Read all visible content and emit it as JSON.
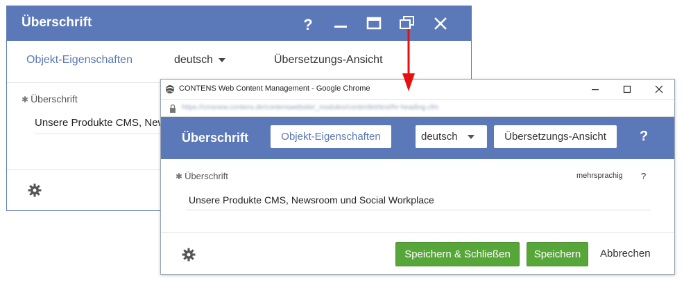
{
  "dialog_back": {
    "title": "Überschrift",
    "controls": {
      "help": "?"
    },
    "tabs": {
      "properties": "Objekt-Eigenschaften",
      "language": "deutsch",
      "translation": "Übersetzungs-Ansicht"
    },
    "field": {
      "label": "Überschrift",
      "value": "Unsere Produkte CMS, News"
    }
  },
  "browser": {
    "window_title": "CONTENS Web Content Management - Google Chrome",
    "url": "https://cmsnew.contens.de/contenswebsite/_modules/contentlet/text/hr-heading.cfm"
  },
  "dialog_front": {
    "title": "Überschrift",
    "tabs": {
      "properties": "Objekt-Eigenschaften",
      "language": "deutsch",
      "translation": "Übersetzungs-Ansicht"
    },
    "help": "?",
    "field": {
      "label": "Überschrift",
      "multilingual": "mehrsprachig",
      "help": "?",
      "value": "Unsere Produkte CMS, Newsroom und Social Workplace"
    },
    "buttons": {
      "save_close": "Speichern & Schließen",
      "save": "Speichern",
      "cancel": "Abbrechen"
    }
  },
  "colors": {
    "header_blue": "#5b78b8",
    "button_green": "#57a639",
    "arrow_red": "#e8100f"
  }
}
